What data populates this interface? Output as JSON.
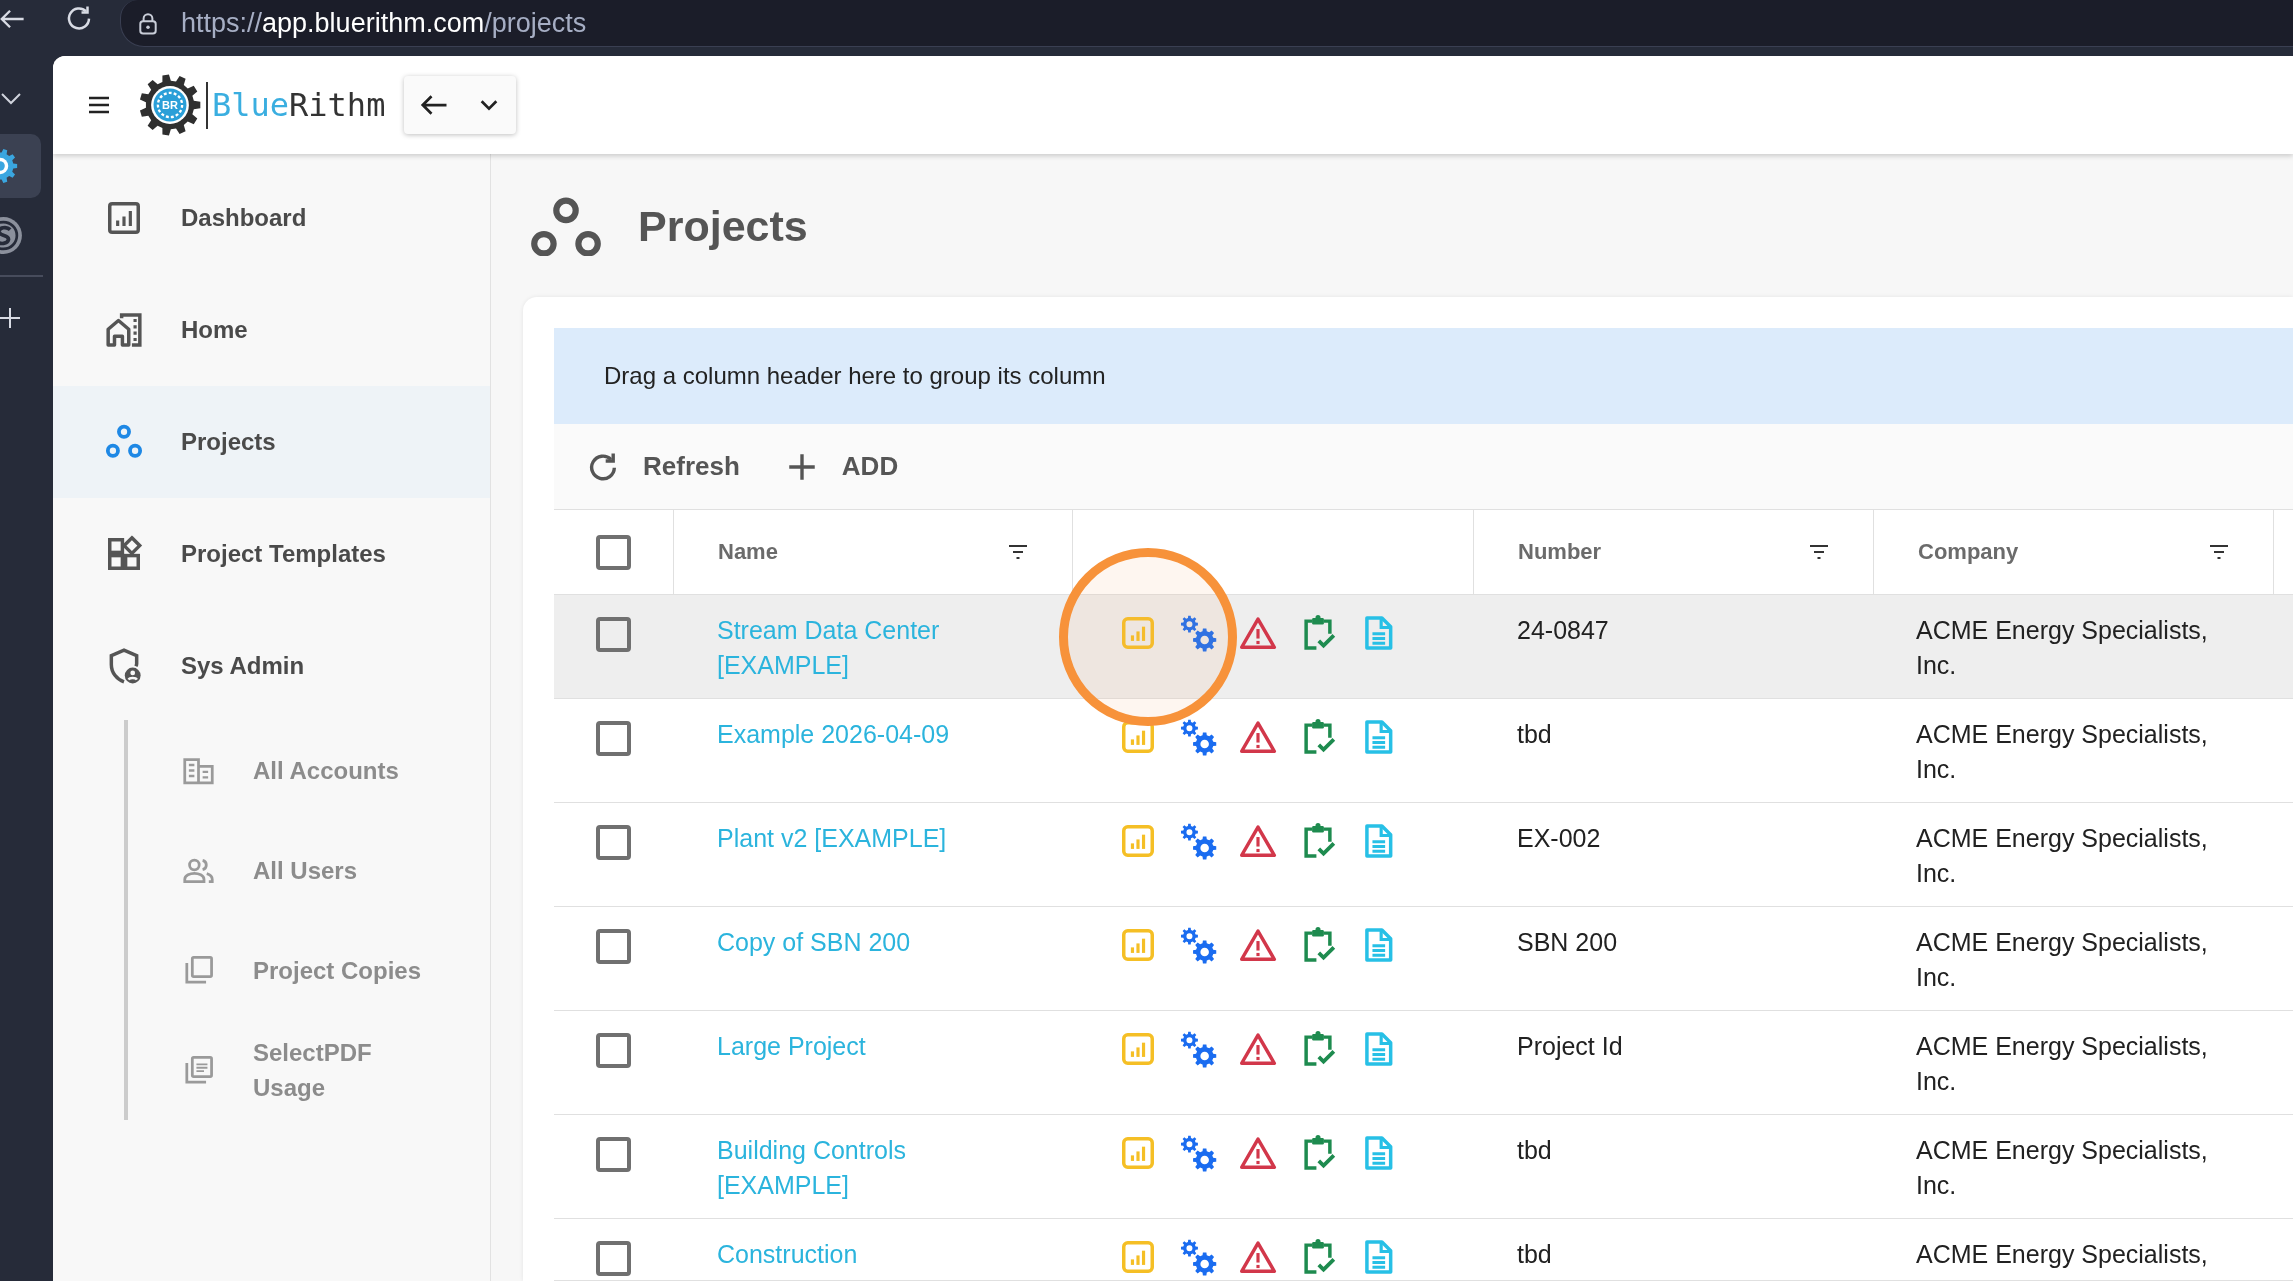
{
  "browser": {
    "address_bar": {
      "scheme": "https://",
      "host": "app.bluerithm.com",
      "path": "/projects"
    },
    "tabs": [
      {
        "selected": true
      },
      {
        "selected": false
      }
    ]
  },
  "app_header": {
    "logo": {
      "initials": "BR",
      "wordmark_first": "Blue",
      "wordmark_second": "Rithm"
    }
  },
  "sidebar": {
    "items": [
      {
        "label": "Dashboard",
        "selected": false
      },
      {
        "label": "Home",
        "selected": false
      },
      {
        "label": "Projects",
        "selected": true
      },
      {
        "label": "Project Templates",
        "selected": false
      },
      {
        "label": "Sys Admin",
        "selected": false,
        "expanded": true,
        "children": [
          {
            "label": "All Accounts",
            "selected": false
          },
          {
            "label": "All Users",
            "selected": false
          },
          {
            "label": "Project Copies",
            "selected": false
          },
          {
            "label": "SelectPDF Usage",
            "selected": false
          }
        ]
      }
    ]
  },
  "page": {
    "title": "Projects"
  },
  "grid": {
    "group_panel": {
      "text": "Drag a column header here to group its column"
    },
    "toolbar": [
      {
        "label": "Refresh"
      },
      {
        "label": "ADD"
      }
    ],
    "select_all": {
      "checked": false
    },
    "columns": [
      {
        "kind": "text",
        "label": "Name",
        "filterable": true
      },
      {
        "kind": "actions"
      },
      {
        "kind": "text",
        "label": "Number",
        "filterable": true
      },
      {
        "kind": "text",
        "label": "Company",
        "filterable": true
      }
    ],
    "rows": [
      {
        "name": "Stream Data Center [EXAMPLE]",
        "number": "24-0847",
        "company": "ACME Energy Specialists, Inc.",
        "checked": false,
        "hovered": true,
        "callout": true
      },
      {
        "name": "Example 2026-04-09",
        "number": "tbd",
        "company": "ACME Energy Specialists, Inc.",
        "checked": false,
        "hovered": false,
        "callout": false
      },
      {
        "name": "Plant v2 [EXAMPLE]",
        "number": "EX-002",
        "company": "ACME Energy Specialists, Inc.",
        "checked": false,
        "hovered": false,
        "callout": false
      },
      {
        "name": "Copy of SBN 200",
        "number": "SBN 200",
        "company": "ACME Energy Specialists, Inc.",
        "checked": false,
        "hovered": false,
        "callout": false
      },
      {
        "name": "Large Project",
        "number": "Project Id",
        "company": "ACME Energy Specialists, Inc.",
        "checked": false,
        "hovered": false,
        "callout": false
      },
      {
        "name": "Building Controls [EXAMPLE]",
        "number": "tbd",
        "company": "ACME Energy Specialists, Inc.",
        "checked": false,
        "hovered": false,
        "callout": false
      },
      {
        "name": "Construction",
        "number": "tbd",
        "company": "ACME Energy Specialists,",
        "checked": false,
        "hovered": false,
        "callout": false
      }
    ]
  }
}
